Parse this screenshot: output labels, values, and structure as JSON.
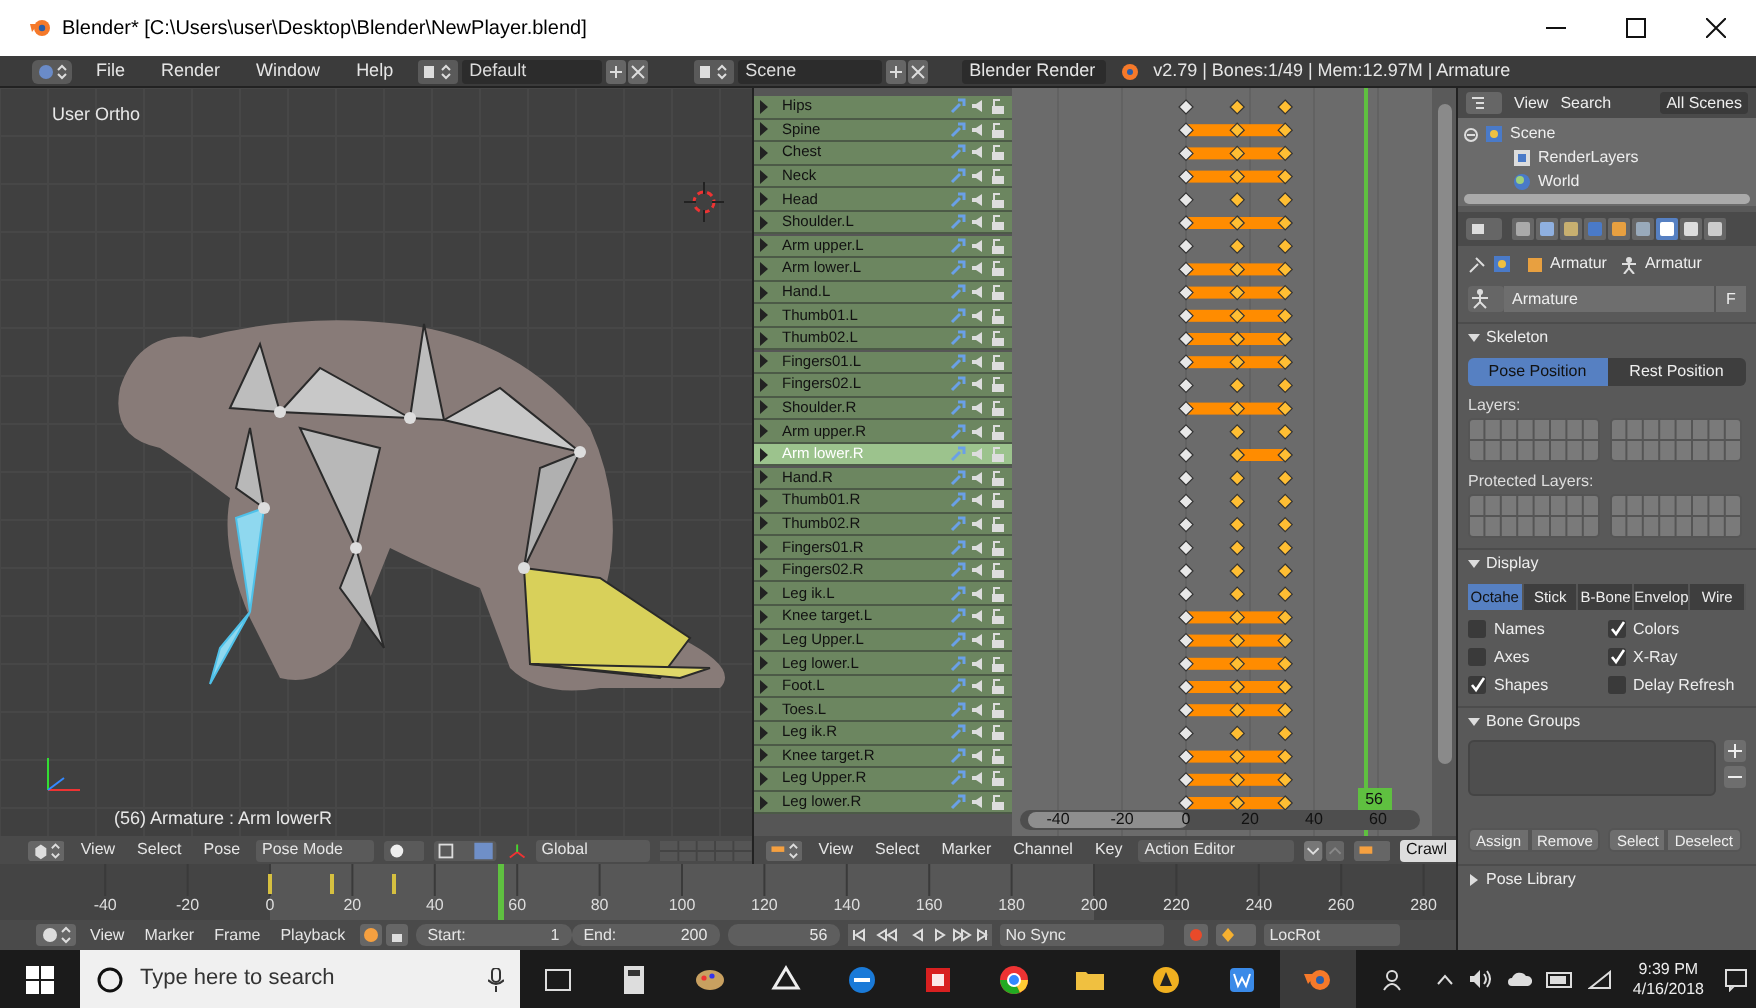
{
  "window": {
    "title": "Blender* [C:\\Users\\user\\Desktop\\Blender\\NewPlayer.blend]"
  },
  "top_header": {
    "menus": [
      "File",
      "Render",
      "Window",
      "Help"
    ],
    "layout": "Default",
    "scene": "Scene",
    "engine": "Blender Render",
    "stats": "v2.79 | Bones:1/49 | Mem:12.97M | Armature"
  },
  "viewport": {
    "view_label": "User Ortho",
    "status": "(56) Armature : Arm lowerR",
    "header": {
      "menus": [
        "View",
        "Select",
        "Pose"
      ],
      "mode": "Pose Mode",
      "orientation": "Global"
    }
  },
  "action_editor": {
    "channels": [
      {
        "name": "Hips",
        "selected": false,
        "holds": [
          false,
          false
        ]
      },
      {
        "name": "Spine",
        "selected": false,
        "holds": [
          true,
          true
        ]
      },
      {
        "name": "Chest",
        "selected": false,
        "holds": [
          true,
          true
        ]
      },
      {
        "name": "Neck",
        "selected": false,
        "holds": [
          true,
          true
        ]
      },
      {
        "name": "Head",
        "selected": false,
        "holds": [
          false,
          false
        ]
      },
      {
        "name": "Shoulder.L",
        "selected": false,
        "holds": [
          true,
          true
        ]
      },
      {
        "name": "Arm upper.L",
        "selected": false,
        "holds": [
          false,
          false
        ]
      },
      {
        "name": "Arm lower.L",
        "selected": false,
        "holds": [
          true,
          true
        ]
      },
      {
        "name": "Hand.L",
        "selected": false,
        "holds": [
          true,
          true
        ]
      },
      {
        "name": "Thumb01.L",
        "selected": false,
        "holds": [
          true,
          true
        ]
      },
      {
        "name": "Thumb02.L",
        "selected": false,
        "holds": [
          true,
          true
        ]
      },
      {
        "name": "Fingers01.L",
        "selected": false,
        "holds": [
          true,
          true
        ]
      },
      {
        "name": "Fingers02.L",
        "selected": false,
        "holds": [
          false,
          false
        ]
      },
      {
        "name": "Shoulder.R",
        "selected": false,
        "holds": [
          true,
          true
        ]
      },
      {
        "name": "Arm upper.R",
        "selected": false,
        "holds": [
          false,
          false
        ]
      },
      {
        "name": "Arm lower.R",
        "selected": true,
        "holds": [
          false,
          true
        ]
      },
      {
        "name": "Hand.R",
        "selected": false,
        "holds": [
          false,
          false
        ]
      },
      {
        "name": "Thumb01.R",
        "selected": false,
        "holds": [
          false,
          false
        ]
      },
      {
        "name": "Thumb02.R",
        "selected": false,
        "holds": [
          false,
          false
        ]
      },
      {
        "name": "Fingers01.R",
        "selected": false,
        "holds": [
          false,
          false
        ]
      },
      {
        "name": "Fingers02.R",
        "selected": false,
        "holds": [
          false,
          false
        ]
      },
      {
        "name": "Leg ik.L",
        "selected": false,
        "holds": [
          false,
          false
        ]
      },
      {
        "name": "Knee target.L",
        "selected": false,
        "holds": [
          true,
          true
        ]
      },
      {
        "name": "Leg Upper.L",
        "selected": false,
        "holds": [
          true,
          true
        ]
      },
      {
        "name": "Leg lower.L",
        "selected": false,
        "holds": [
          true,
          true
        ]
      },
      {
        "name": "Foot.L",
        "selected": false,
        "holds": [
          true,
          true
        ]
      },
      {
        "name": "Toes.L",
        "selected": false,
        "holds": [
          true,
          true
        ]
      },
      {
        "name": "Leg ik.R",
        "selected": false,
        "holds": [
          false,
          false
        ]
      },
      {
        "name": "Knee target.R",
        "selected": false,
        "holds": [
          true,
          true
        ]
      },
      {
        "name": "Leg Upper.R",
        "selected": false,
        "holds": [
          true,
          true
        ]
      },
      {
        "name": "Leg lower.R",
        "selected": false,
        "holds": [
          true,
          true
        ]
      }
    ],
    "current_frame": "56",
    "ruler": [
      "-40",
      "-20",
      "0",
      "20",
      "40",
      "60"
    ],
    "header": {
      "menus": [
        "View",
        "Select",
        "Marker",
        "Channel",
        "Key"
      ],
      "mode": "Action Editor",
      "action": "Crawl"
    }
  },
  "timeline": {
    "ruler": [
      "-40",
      "-20",
      "0",
      "20",
      "40",
      "60",
      "80",
      "100",
      "120",
      "140",
      "160",
      "180",
      "200",
      "220",
      "240",
      "260",
      "280"
    ],
    "header": {
      "menus": [
        "View",
        "Marker",
        "Frame",
        "Playback"
      ],
      "start_label": "Start:",
      "start": "1",
      "end_label": "End:",
      "end": "200",
      "current": "56",
      "sync": "No Sync",
      "keying_set": "LocRot"
    }
  },
  "outliner": {
    "menus": [
      "View",
      "Search"
    ],
    "filter": "All Scenes",
    "tree": [
      {
        "label": "Scene",
        "expanded": true,
        "children": [
          {
            "label": "RenderLayers"
          },
          {
            "label": "World"
          }
        ]
      }
    ]
  },
  "properties": {
    "context_tabs": [
      {
        "selected": false
      },
      {
        "selected": false
      },
      {
        "selected": false
      },
      {
        "selected": false
      },
      {
        "selected": false
      },
      {
        "selected": false
      },
      {
        "selected": true
      },
      {
        "selected": false
      },
      {
        "selected": false
      }
    ],
    "breadcrumb": [
      "Armatur",
      "Armatur"
    ],
    "name": "Armature",
    "fake_user": "F",
    "skeleton": {
      "title": "Skeleton",
      "positions": [
        {
          "label": "Pose Position",
          "selected": true
        },
        {
          "label": "Rest Position",
          "selected": false
        }
      ],
      "layers_label": "Layers:",
      "protected_label": "Protected Layers:"
    },
    "display": {
      "title": "Display",
      "modes": [
        {
          "label": "Octahe",
          "selected": true
        },
        {
          "label": "Stick",
          "selected": false
        },
        {
          "label": "B-Bone",
          "selected": false
        },
        {
          "label": "Envelop",
          "selected": false
        },
        {
          "label": "Wire",
          "selected": false
        }
      ],
      "options": [
        {
          "label": "Names",
          "checked": false
        },
        {
          "label": "Colors",
          "checked": true
        },
        {
          "label": "Axes",
          "checked": false
        },
        {
          "label": "X-Ray",
          "checked": true
        },
        {
          "label": "Shapes",
          "checked": true
        },
        {
          "label": "Delay Refresh",
          "checked": false
        }
      ]
    },
    "bone_groups": {
      "title": "Bone Groups",
      "buttons": [
        "Assign",
        "Remove",
        "Select",
        "Deselect"
      ]
    },
    "pose_library": {
      "title": "Pose Library"
    }
  },
  "taskbar": {
    "search_placeholder": "Type here to search",
    "time": "9:39 PM",
    "date": "4/16/2018"
  }
}
